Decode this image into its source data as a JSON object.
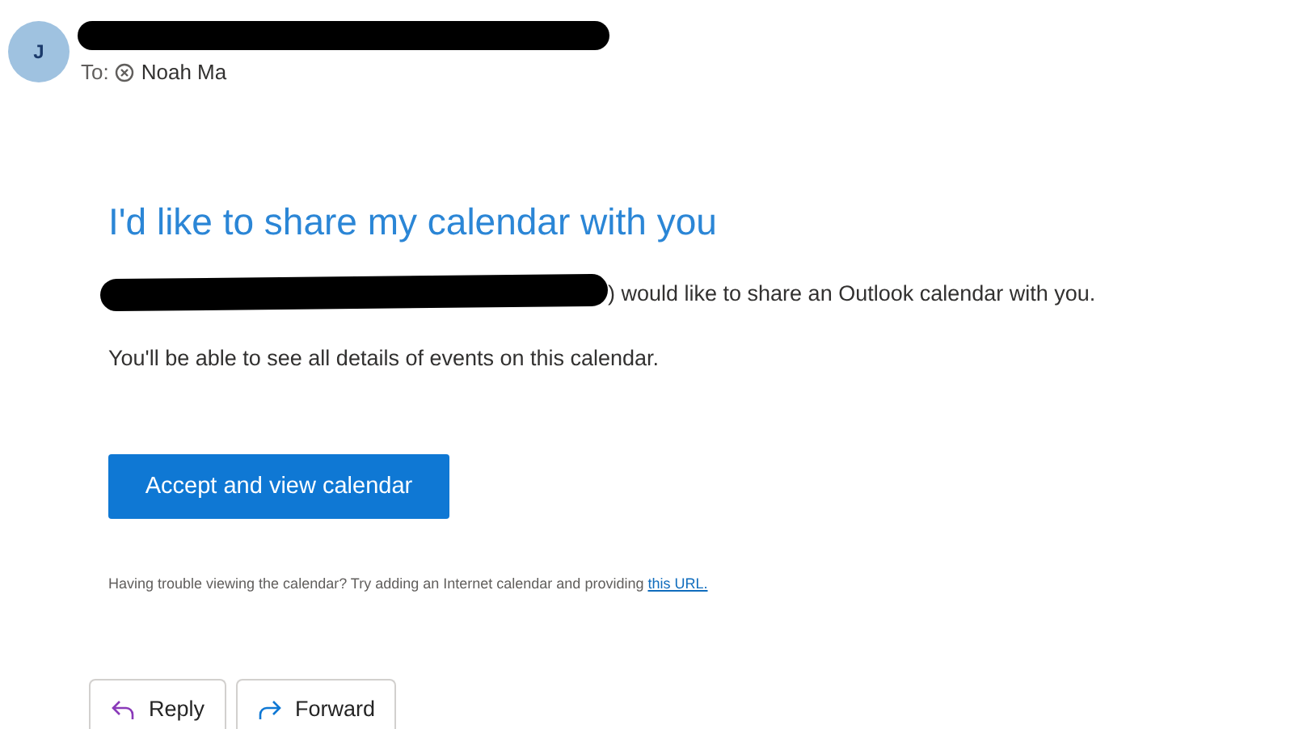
{
  "header": {
    "avatar_initial": "J",
    "to_label": "To:",
    "recipient": "Noah Ma"
  },
  "message": {
    "heading": "I'd like to share my calendar with you",
    "intro": ") would like to share an Outlook calendar with you.",
    "details": "You'll be able to see all details of events on this calendar.",
    "accept_button": "Accept and view calendar",
    "help_text": "Having trouble viewing the calendar? Try adding an Internet calendar and providing",
    "help_link": "this URL."
  },
  "actions": [
    {
      "kind": "reply",
      "label": "Reply"
    },
    {
      "kind": "forward",
      "label": "Forward"
    }
  ]
}
